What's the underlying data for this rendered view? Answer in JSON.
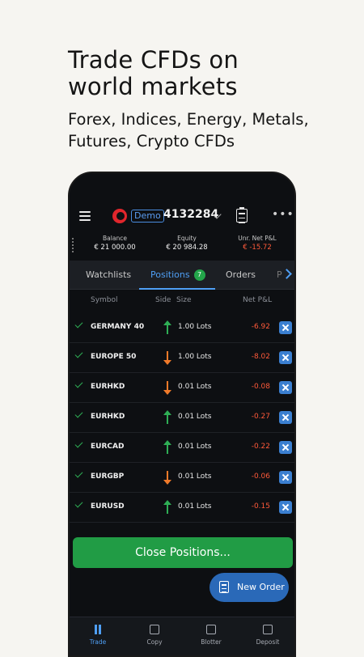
{
  "promo": {
    "title": "Trade CFDs on world markets",
    "subtitle": "Forex, Indices, Energy, Metals, Futures, Crypto CFDs"
  },
  "header": {
    "account_type": "Demo",
    "account_number": "4132284"
  },
  "stats": {
    "balance_label": "Balance",
    "balance_value": "€ 21 000.00",
    "equity_label": "Equity",
    "equity_value": "€ 20 984.28",
    "pnl_label": "Unr. Net P&L",
    "pnl_value": "€ -15.72"
  },
  "tabs": {
    "watchlists": "Watchlists",
    "positions": "Positions",
    "positions_count": "7",
    "orders": "Orders",
    "next_partial": "P"
  },
  "columns": {
    "symbol": "Symbol",
    "side": "Side",
    "size": "Size",
    "net_pnl": "Net P&L"
  },
  "positions": [
    {
      "symbol": "GERMANY 40",
      "side": "buy",
      "size": "1.00 Lots",
      "pnl": "-6.92"
    },
    {
      "symbol": "EUROPE 50",
      "side": "sell",
      "size": "1.00 Lots",
      "pnl": "-8.02"
    },
    {
      "symbol": "EURHKD",
      "side": "sell",
      "size": "0.01 Lots",
      "pnl": "-0.08"
    },
    {
      "symbol": "EURHKD",
      "side": "buy",
      "size": "0.01 Lots",
      "pnl": "-0.27"
    },
    {
      "symbol": "EURCAD",
      "side": "buy",
      "size": "0.01 Lots",
      "pnl": "-0.22"
    },
    {
      "symbol": "EURGBP",
      "side": "sell",
      "size": "0.01 Lots",
      "pnl": "-0.06"
    },
    {
      "symbol": "EURUSD",
      "side": "buy",
      "size": "0.01 Lots",
      "pnl": "-0.15"
    }
  ],
  "actions": {
    "close_positions": "Close Positions...",
    "new_order": "New Order"
  },
  "nav": {
    "trade": "Trade",
    "copy": "Copy",
    "blotter": "Blotter",
    "deposit": "Deposit"
  },
  "colors": {
    "accent": "#4f9ff5",
    "positive": "#2eae55",
    "negative": "#ff5a3a",
    "sell": "#f07a2a",
    "close_button": "#219c45",
    "new_order_button": "#2a69b8"
  }
}
